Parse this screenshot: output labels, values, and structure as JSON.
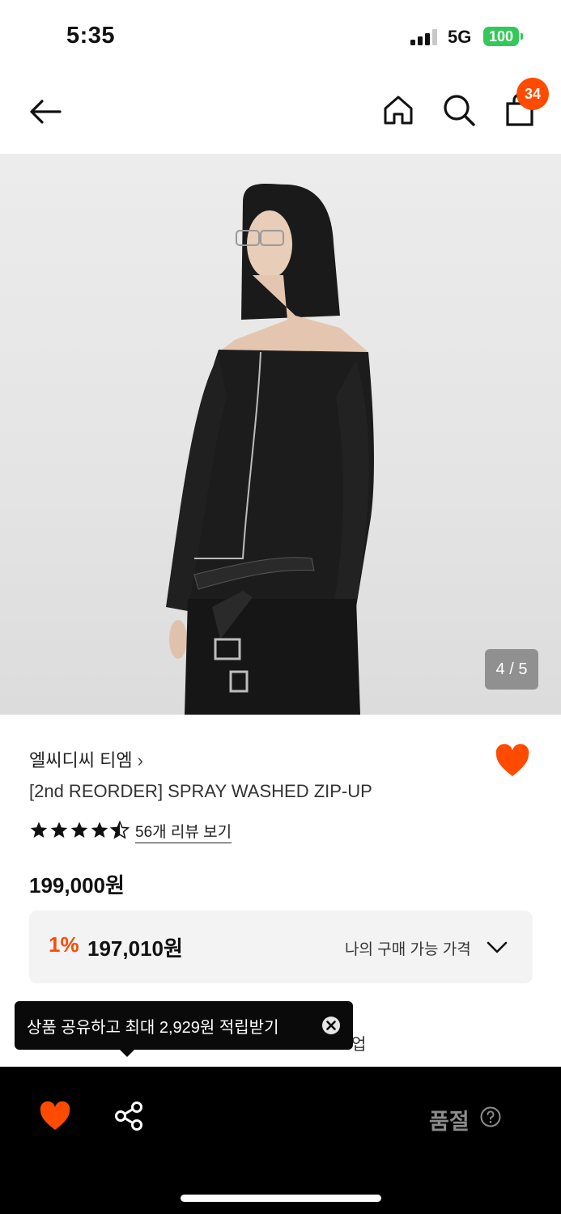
{
  "status_bar": {
    "time": "5:35",
    "network": "5G",
    "battery": "100"
  },
  "header": {
    "cart_count": "34"
  },
  "gallery": {
    "counter": "4 / 5"
  },
  "product": {
    "brand": "엘씨디씨 티엠",
    "brand_chevron": "›",
    "name": "[2nd REORDER] SPRAY WASHED ZIP-UP",
    "rating_stars": 4.5,
    "review_link": "56개 리뷰 보기",
    "price": "199,000원"
  },
  "my_price": {
    "discount": "1%",
    "price": "197,010원",
    "label": "나의 구매 가능 가격"
  },
  "partial_text": "업",
  "tooltip": {
    "text": "상품 공유하고 최대 2,929원 적립받기"
  },
  "bottom_bar": {
    "status": "품절"
  },
  "colors": {
    "accent": "#ff4b00",
    "battery": "#34c759"
  }
}
